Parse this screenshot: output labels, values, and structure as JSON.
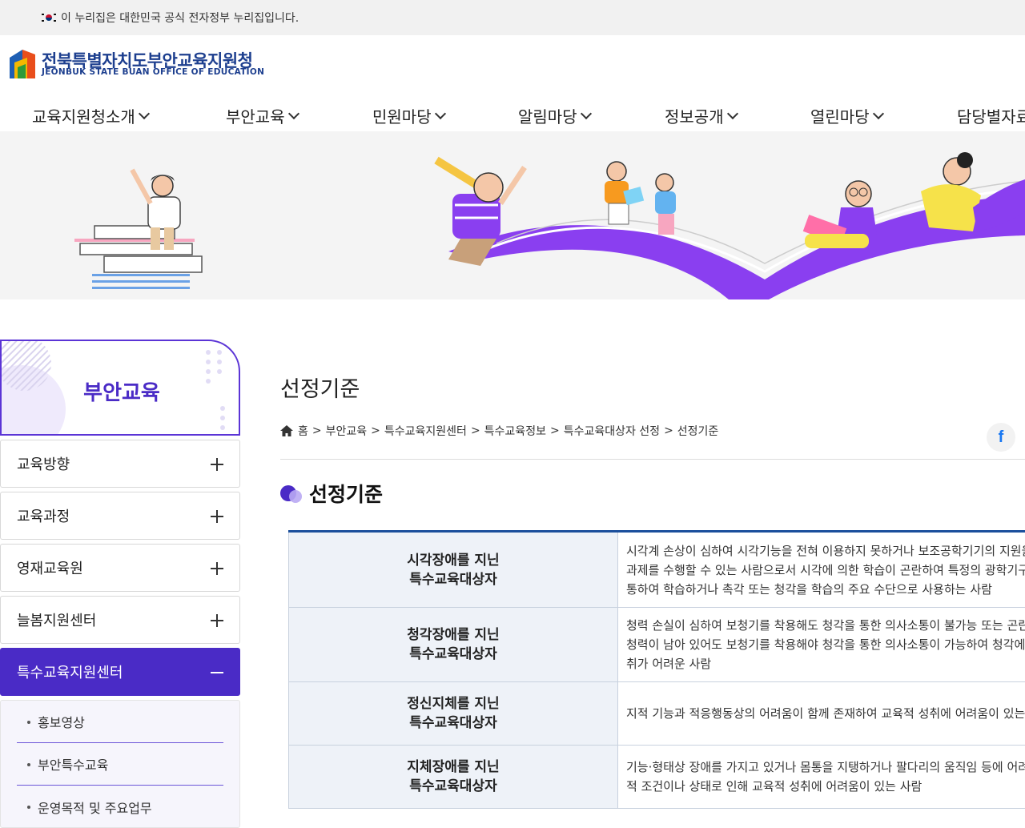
{
  "topbar": {
    "notice": "이 누리집은 대한민국 공식 전자정부 누리집입니다."
  },
  "header": {
    "org_name": "전북특별자치도부안교육지원청",
    "org_name_en": "JEONBUK STATE BUAN OFFICE OF EDUCATION"
  },
  "gnb": {
    "items": [
      {
        "label": "교육지원청소개"
      },
      {
        "label": "부안교육"
      },
      {
        "label": "민원마당"
      },
      {
        "label": "알림마당"
      },
      {
        "label": "정보공개"
      },
      {
        "label": "열린마당"
      },
      {
        "label": "담당별자료"
      }
    ]
  },
  "sidebar": {
    "title": "부안교육",
    "items": [
      {
        "label": "교육방향"
      },
      {
        "label": "교육과정"
      },
      {
        "label": "영재교육원"
      },
      {
        "label": "늘봄지원센터"
      },
      {
        "label": "특수교육지원센터"
      }
    ],
    "sub_items": [
      {
        "label": "홍보영상"
      },
      {
        "label": "부안특수교육"
      },
      {
        "label": "운영목적 및 주요업무"
      }
    ]
  },
  "content": {
    "page_title": "선정기준",
    "breadcrumb": [
      "홈",
      "부안교육",
      "특수교육지원센터",
      "특수교육정보",
      "특수교육대상자 선정",
      "선정기준"
    ],
    "facebook_label": "f",
    "section_title": "선정기준",
    "table": [
      {
        "head1": "시각장애를 지닌",
        "head2": "특수교육대상자",
        "lines": [
          "시각계 손상이 심하여 시각기능을 전혀 이용하지 못하거나 보조공학기기의 지원을 받아야 시각적",
          "과제를 수행할 수 있는 사람으로서 시각에 의한 학습이 곤란하여 특정의 광학기구·학습매체 등을",
          "통하여 학습하거나 촉각 또는 청각을 학습의 주요 수단으로 사용하는 사람"
        ]
      },
      {
        "head1": "청각장애를 지닌",
        "head2": "특수교육대상자",
        "lines": [
          "청력 손실이 심하여 보청기를 착용해도 청각을 통한 의사소통이 불가능 또는 곤란한 상태이거나,",
          "청력이 남아 있어도 보청기를 착용해야 청각을 통한 의사소통이 가능하여 청각에 의한 교육적 성취가",
          "취가 어려운 사람"
        ]
      },
      {
        "head1": "정신지체를 지닌",
        "head2": "특수교육대상자",
        "lines": [
          "지적 기능과 적응행동상의 어려움이 함께 존재하여 교육적 성취에 어려움이 있는 사람"
        ]
      },
      {
        "head1": "지체장애를 지닌",
        "head2": "특수교육대상자",
        "lines": [
          "기능·형태상 장애를 가지고 있거나 몸통을 지탱하거나 팔다리의 움직임 등에 어려움을 겪는 신체",
          "적 조건이나 상태로 인해 교육적 성취에 어려움이 있는 사람"
        ]
      }
    ]
  },
  "colors": {
    "brand": "#1d3f8f",
    "accent": "#4a2bc6",
    "table_line": "#1b4f9c"
  }
}
